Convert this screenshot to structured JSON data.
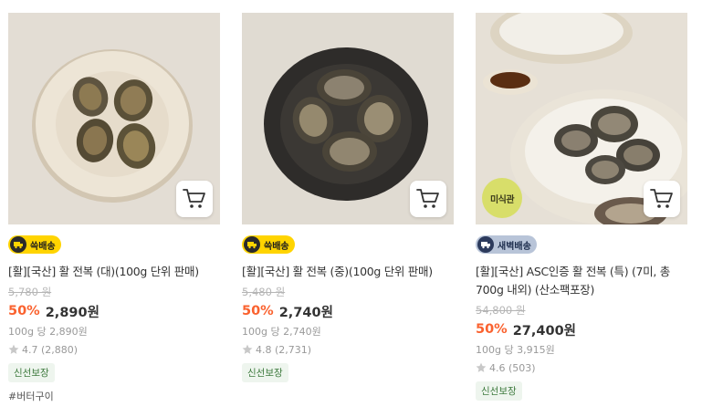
{
  "products": [
    {
      "delivery": "쓱배송",
      "title": "[활][국산] 활 전복 (대)(100g 단위 판매)",
      "original_price": "5,780 원",
      "discount": "50%",
      "price": "2,890원",
      "unit_price": "100g 당 2,890원",
      "rating": "4.7 (2,880)",
      "tag": "신선보장",
      "hashtag": "#버터구이"
    },
    {
      "delivery": "쓱배송",
      "title": "[활][국산] 활 전복 (중)(100g 단위 판매)",
      "original_price": "5,480 원",
      "discount": "50%",
      "price": "2,740원",
      "unit_price": "100g 당 2,740원",
      "rating": "4.8 (2,731)",
      "tag": "신선보장"
    },
    {
      "badge": "미식관",
      "delivery": "새벽배송",
      "title": "[활][국산] ASC인증 활 전복 (특) (7미, 총 700g 내외) (산소팩포장)",
      "original_price": "54,800 원",
      "discount": "50%",
      "price": "27,400원",
      "unit_price": "100g 당 3,915원",
      "rating": "4.6 (503)",
      "tag": "신선보장"
    }
  ],
  "icons": {
    "cart": "cart-icon",
    "truck": "truck-icon",
    "star": "star-icon"
  },
  "colors": {
    "discount": "#fa622f",
    "fast_delivery": "#ffd400",
    "dawn_delivery": "#b8c4d8",
    "badge": "#d8de6a"
  }
}
